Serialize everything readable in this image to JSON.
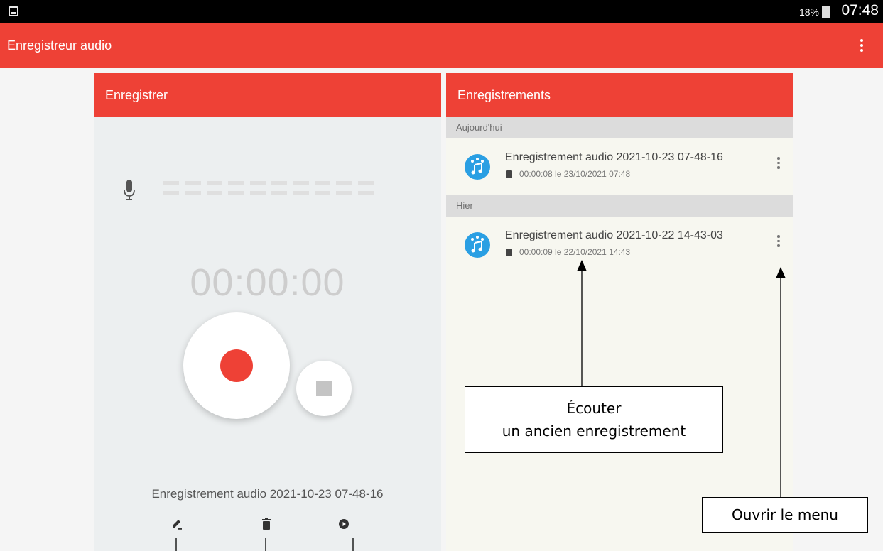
{
  "status_bar": {
    "battery_percent": "18%",
    "time": "07:48"
  },
  "app_bar": {
    "title": "Enregistreur audio"
  },
  "record_panel": {
    "header": "Enregistrer",
    "timer": "00:00:00",
    "current_recording_name": "Enregistrement audio 2021-10-23 07-48-16",
    "tools": [
      "edit-icon",
      "delete-icon",
      "play-icon"
    ]
  },
  "recordings_panel": {
    "header": "Enregistrements",
    "sections": [
      {
        "label": "Aujourd'hui",
        "items": [
          {
            "title": "Enregistrement audio 2021-10-23 07-48-16",
            "meta": "00:00:08 le 23/10/2021 07:48"
          }
        ]
      },
      {
        "label": "Hier",
        "items": [
          {
            "title": "Enregistrement audio 2021-10-22 14-43-03",
            "meta": "00:00:09 le 22/10/2021 14:43"
          }
        ]
      }
    ]
  },
  "annotations": {
    "listen_line1": "Écouter",
    "listen_line2": "un ancien enregistrement",
    "open_menu": "Ouvrir le menu"
  },
  "colors": {
    "accent": "#ee4136",
    "icon_blue": "#2a9fe3"
  }
}
